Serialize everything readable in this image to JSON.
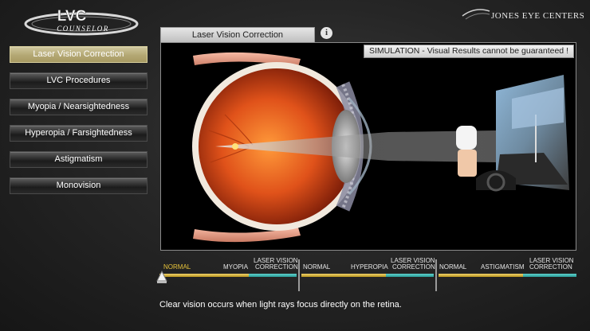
{
  "logo": {
    "line1": "LVC",
    "line2": "COUNSELOR"
  },
  "brand": {
    "name": "JONES EYE CENTERS"
  },
  "sidebar": {
    "items": [
      {
        "label": "Laser Vision Correction",
        "active": true
      },
      {
        "label": "LVC Procedures"
      },
      {
        "label": "Myopia / Nearsightedness"
      },
      {
        "label": "Hyperopia / Farsightedness"
      },
      {
        "label": "Astigmatism"
      },
      {
        "label": "Monovision"
      }
    ]
  },
  "viewer": {
    "tab_label": "Laser Vision Correction",
    "info_icon": "i",
    "simulation_banner": "SIMULATION - Visual Results cannot be guaranteed !"
  },
  "slider": {
    "segments": [
      {
        "start_label": "NORMAL",
        "end_label": "MYOPIA",
        "correction_label_1": "LASER VISION",
        "correction_label_2": "CORRECTION"
      },
      {
        "start_label": "NORMAL",
        "end_label": "HYPEROPIA",
        "correction_label_1": "LASER VISION",
        "correction_label_2": "CORRECTION"
      },
      {
        "start_label": "NORMAL",
        "end_label": "ASTIGMATISM",
        "correction_label_1": "LASER VISION",
        "correction_label_2": "CORRECTION"
      }
    ],
    "position": 0
  },
  "caption": "Clear vision occurs when light rays focus directly on the retina.",
  "colors": {
    "active": "#b4a874",
    "gold": "#d4b040",
    "teal": "#3cb4ae",
    "normal_label": "#e6c23a"
  }
}
